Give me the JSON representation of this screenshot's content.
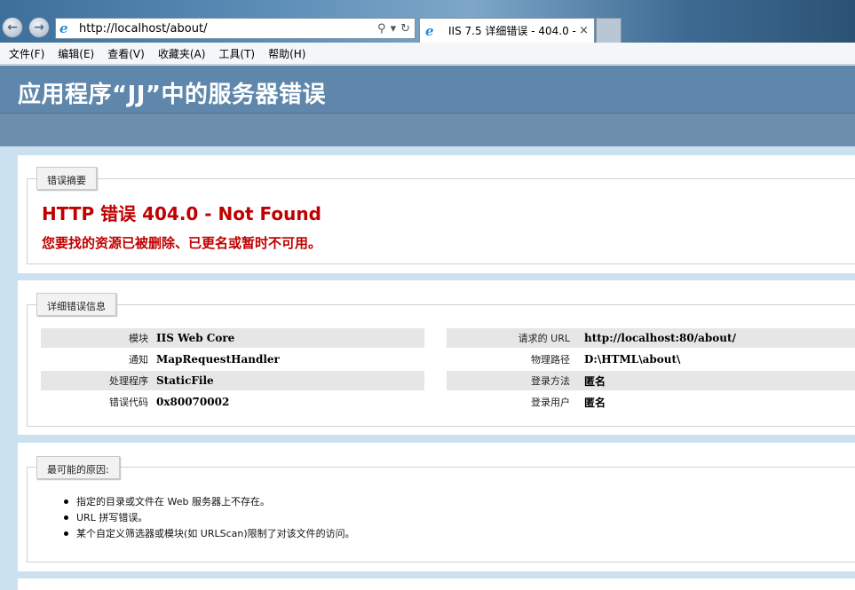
{
  "browser": {
    "address_url": "http://localhost/about/",
    "tab_title": "IIS 7.5 详细错误 - 404.0 - ...",
    "tab_close": "×",
    "back_glyph": "←",
    "forward_glyph": "→",
    "icons": [
      "back-icon",
      "forward-icon",
      "ie-logo-icon",
      "search-icon",
      "dropdown-icon",
      "refresh-icon",
      "close-icon"
    ]
  },
  "menu": [
    "文件(F)",
    "编辑(E)",
    "查看(V)",
    "收藏夹(A)",
    "工具(T)",
    "帮助(H)"
  ],
  "page": {
    "title": "应用程序“JJ”中的服务器错误"
  },
  "summary": {
    "legend": "错误摘要",
    "error_title": "HTTP 错误 404.0 - Not Found",
    "error_desc": "您要找的资源已被删除、已更名或暂时不可用。"
  },
  "details": {
    "legend": "详细错误信息",
    "left": [
      {
        "label": "模块",
        "value": "IIS Web Core"
      },
      {
        "label": "通知",
        "value": "MapRequestHandler"
      },
      {
        "label": "处理程序",
        "value": "StaticFile"
      },
      {
        "label": "错误代码",
        "value": "0x80070002"
      }
    ],
    "right": [
      {
        "label": "请求的 URL",
        "value": "http://localhost:80/about/"
      },
      {
        "label": "物理路径",
        "value": "D:\\HTML\\about\\"
      },
      {
        "label": "登录方法",
        "value": "匿名"
      },
      {
        "label": "登录用户",
        "value": "匿名"
      }
    ]
  },
  "causes": {
    "legend": "最可能的原因:",
    "items": [
      "指定的目录或文件在 Web 服务器上不存在。",
      "URL 拼写错误。",
      "某个自定义筛选器或模块(如 URLScan)限制了对该文件的访问。"
    ]
  }
}
